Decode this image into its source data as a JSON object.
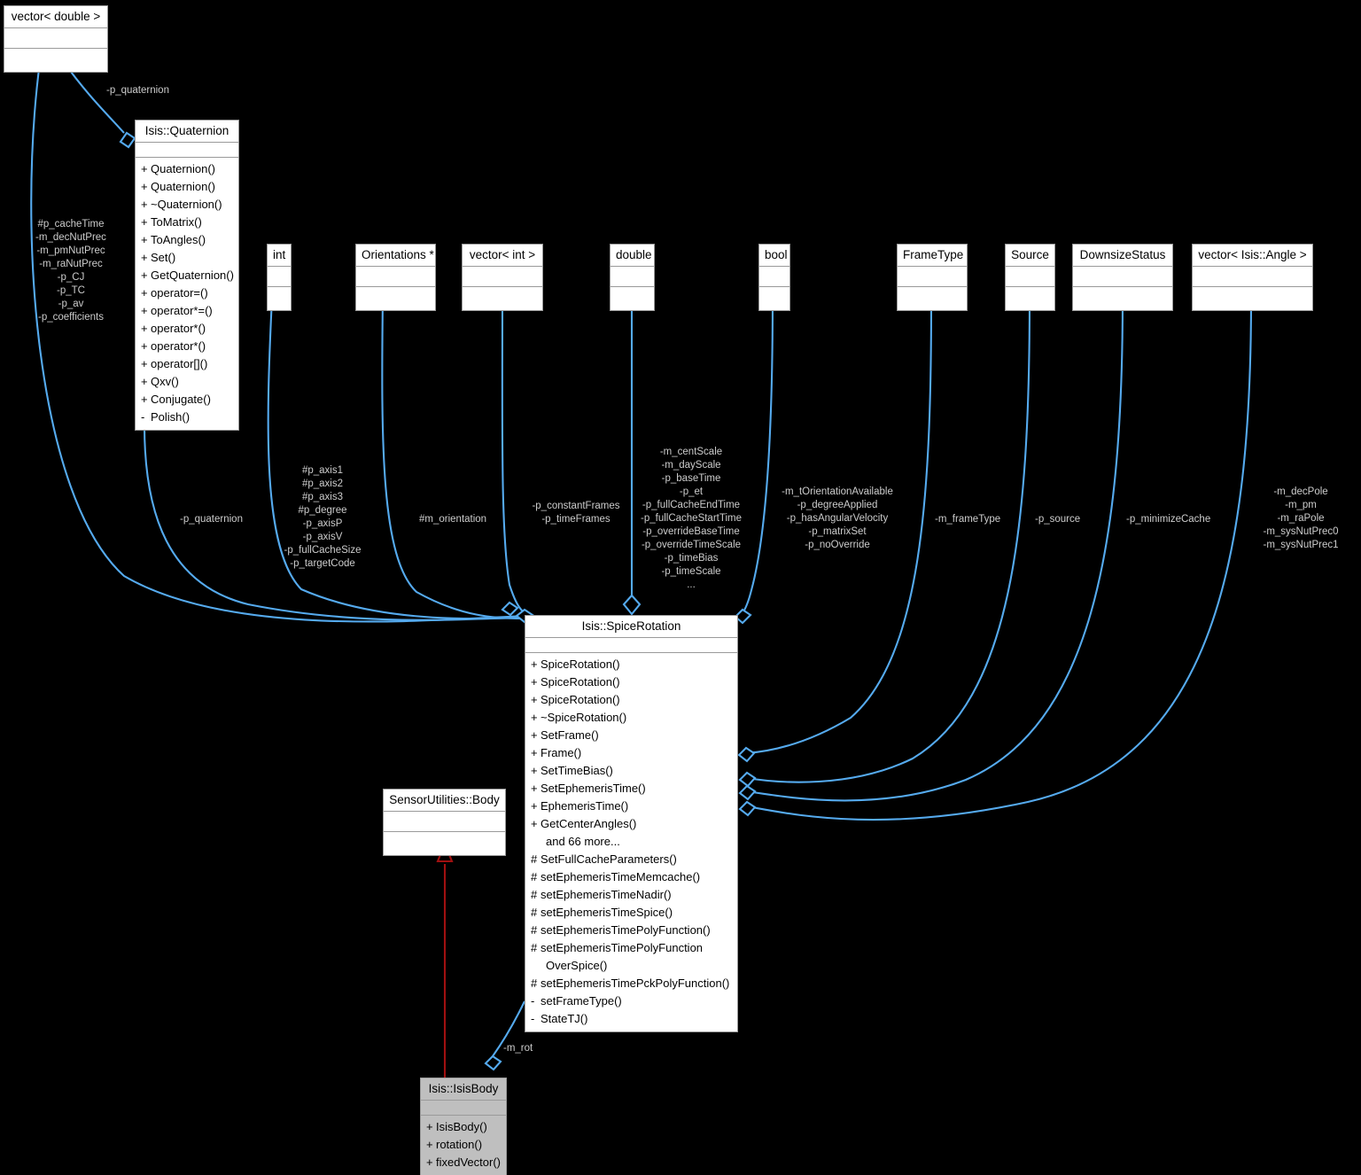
{
  "diagram": {
    "kind": "uml-collaboration-diagram",
    "background": "#000000",
    "edge_color": "#55aaee",
    "inherit_color": "#a01010"
  },
  "classes": {
    "vector_double": {
      "title": "vector< double >",
      "operations": []
    },
    "quaternion": {
      "title": "Isis::Quaternion",
      "operations": [
        {
          "vis": "+",
          "name": "Quaternion()"
        },
        {
          "vis": "+",
          "name": "Quaternion()"
        },
        {
          "vis": "+",
          "name": "~Quaternion()"
        },
        {
          "vis": "+",
          "name": "ToMatrix()"
        },
        {
          "vis": "+",
          "name": "ToAngles()"
        },
        {
          "vis": "+",
          "name": "Set()"
        },
        {
          "vis": "+",
          "name": "GetQuaternion()"
        },
        {
          "vis": "+",
          "name": "operator=()"
        },
        {
          "vis": "+",
          "name": "operator*=()"
        },
        {
          "vis": "+",
          "name": "operator*()"
        },
        {
          "vis": "+",
          "name": "operator*()"
        },
        {
          "vis": "+",
          "name": "operator[]()"
        },
        {
          "vis": "+",
          "name": "Qxv()"
        },
        {
          "vis": "+",
          "name": "Conjugate()"
        },
        {
          "vis": "-",
          "name": "Polish()"
        }
      ]
    },
    "int_t": {
      "title": "int",
      "operations": []
    },
    "orientations_t": {
      "title": "Orientations *",
      "operations": []
    },
    "vector_int": {
      "title": "vector< int >",
      "operations": []
    },
    "double_t": {
      "title": "double",
      "operations": []
    },
    "bool_t": {
      "title": "bool",
      "operations": []
    },
    "frametype_t": {
      "title": "FrameType",
      "operations": []
    },
    "source_t": {
      "title": "Source",
      "operations": []
    },
    "downsizestatus_t": {
      "title": "DownsizeStatus",
      "operations": []
    },
    "vector_angle": {
      "title": "vector< Isis::Angle >",
      "operations": []
    },
    "spicerotation": {
      "title": "Isis::SpiceRotation",
      "operations": [
        {
          "vis": "+",
          "name": "SpiceRotation()"
        },
        {
          "vis": "+",
          "name": "SpiceRotation()"
        },
        {
          "vis": "+",
          "name": "SpiceRotation()"
        },
        {
          "vis": "+",
          "name": "~SpiceRotation()"
        },
        {
          "vis": "+",
          "name": "SetFrame()"
        },
        {
          "vis": "+",
          "name": "Frame()"
        },
        {
          "vis": "+",
          "name": "SetTimeBias()"
        },
        {
          "vis": "+",
          "name": "SetEphemerisTime()"
        },
        {
          "vis": "+",
          "name": "EphemerisTime()"
        },
        {
          "vis": "+",
          "name": "GetCenterAngles()"
        },
        {
          "vis": "",
          "name": "and 66 more..."
        },
        {
          "vis": "#",
          "name": "SetFullCacheParameters()"
        },
        {
          "vis": "#",
          "name": "setEphemerisTimeMemcache()"
        },
        {
          "vis": "#",
          "name": "setEphemerisTimeNadir()"
        },
        {
          "vis": "#",
          "name": "setEphemerisTimeSpice()"
        },
        {
          "vis": "#",
          "name": "setEphemerisTimePolyFunction()"
        },
        {
          "vis": "#",
          "name": "setEphemerisTimePolyFunction"
        },
        {
          "vis": "",
          "name": "OverSpice()",
          "continuation": true
        },
        {
          "vis": "#",
          "name": "setEphemerisTimePckPolyFunction()"
        },
        {
          "vis": "-",
          "name": "setFrameType()"
        },
        {
          "vis": "-",
          "name": "StateTJ()"
        }
      ]
    },
    "sensorutilities_body": {
      "title": "SensorUtilities::Body",
      "operations": []
    },
    "isisbody": {
      "title": "Isis::IsisBody",
      "operations": [
        {
          "vis": "+",
          "name": "IsisBody()"
        },
        {
          "vis": "+",
          "name": "rotation()"
        },
        {
          "vis": "+",
          "name": "fixedVector()"
        }
      ]
    }
  },
  "edge_labels": {
    "p_quaternion_top": "-p_quaternion",
    "vector_double_bundle": "#p_cacheTime\n-m_decNutPrec\n-m_pmNutPrec\n-m_raNutPrec\n-p_CJ\n-p_TC\n-p_av\n-p_coefficients",
    "quaternion_to_spice": "-p_quaternion",
    "int_bundle": "#p_axis1\n#p_axis2\n#p_axis3\n#p_degree\n-p_axisP\n-p_axisV\n-p_fullCacheSize\n-p_targetCode",
    "orientations_label": "#m_orientation",
    "vector_int_bundle": "-p_constantFrames\n-p_timeFrames",
    "double_bundle": "-m_centScale\n-m_dayScale\n-p_baseTime\n-p_et\n-p_fullCacheEndTime\n-p_fullCacheStartTime\n-p_overrideBaseTime\n-p_overrideTimeScale\n-p_timeBias\n-p_timeScale\n...",
    "bool_bundle": "-m_tOrientationAvailable\n-p_degreeApplied\n-p_hasAngularVelocity\n-p_matrixSet\n-p_noOverride",
    "frametype_label": "-m_frameType",
    "source_label": "-p_source",
    "downsizestatus_label": "-p_minimizeCache",
    "vector_angle_bundle": "-m_decPole\n-m_pm\n-m_raPole\n-m_sysNutPrec0\n-m_sysNutPrec1",
    "m_rot_label": "-m_rot"
  }
}
